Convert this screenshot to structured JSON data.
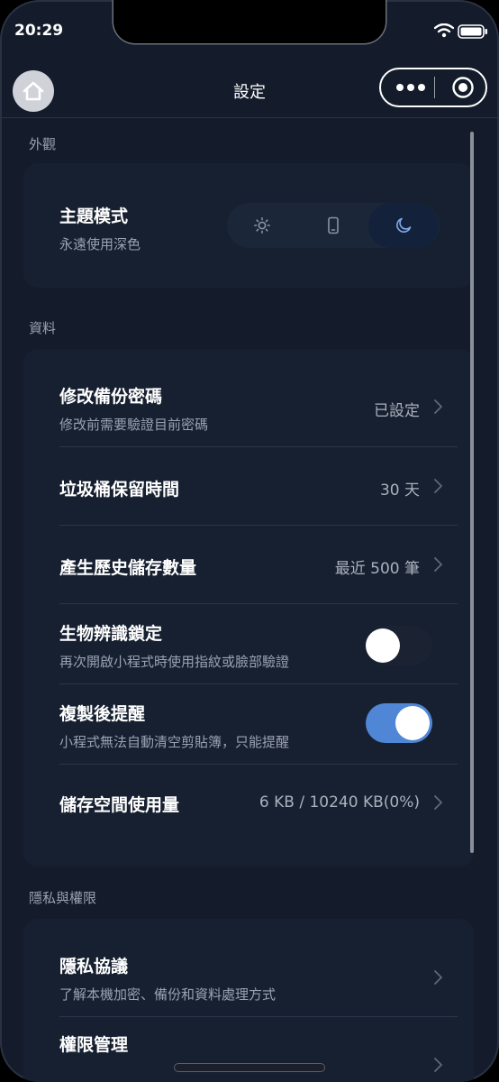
{
  "status": {
    "time": "20:29"
  },
  "nav": {
    "title": "設定"
  },
  "appearance": {
    "section": "外觀",
    "theme": {
      "title": "主題模式",
      "subtitle": "永遠使用深色",
      "options": [
        "sun-icon",
        "phone-icon",
        "moon-icon"
      ],
      "selected": "moon-icon"
    }
  },
  "data": {
    "section": "資料",
    "rows": [
      {
        "title": "修改備份密碼",
        "subtitle": "修改前需要驗證目前密碼",
        "value": "已設定"
      },
      {
        "title": "垃圾桶保留時間",
        "value": "30 天"
      },
      {
        "title": "產生歷史儲存數量",
        "value": "最近 500 筆"
      },
      {
        "title": "生物辨識鎖定",
        "subtitle": "再次開啟小程式時使用指紋或臉部驗證",
        "toggle": false
      },
      {
        "title": "複製後提醒",
        "subtitle": "小程式無法自動清空剪貼簿，只能提醒",
        "toggle": true
      },
      {
        "title": "儲存空間使用量",
        "value": "6 KB / 10240 KB(0%)"
      }
    ]
  },
  "privacy": {
    "section": "隱私與權限",
    "rows": [
      {
        "title": "隱私協議",
        "subtitle": "了解本機加密、備份和資料處理方式"
      },
      {
        "title": "權限管理"
      }
    ]
  },
  "colors": {
    "accent": "#4f86d6",
    "background": "#141c2b",
    "card": "#172030"
  }
}
